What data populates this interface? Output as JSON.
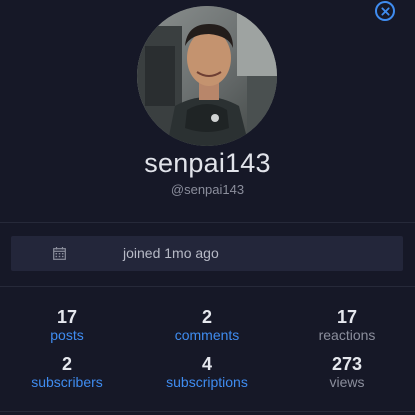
{
  "profile": {
    "display_name": "senpai143",
    "handle": "@senpai143",
    "joined": "joined 1mo ago"
  },
  "icons": {
    "close": "close-icon",
    "calendar": "calendar-icon"
  },
  "colors": {
    "background": "#161827",
    "accent": "#3f8cf0",
    "panel": "#23263a"
  },
  "stats": {
    "posts": {
      "value": "17",
      "label": "posts"
    },
    "comments": {
      "value": "2",
      "label": "comments"
    },
    "reactions": {
      "value": "17",
      "label": "reactions"
    },
    "subscribers": {
      "value": "2",
      "label": "subscribers"
    },
    "subscriptions": {
      "value": "4",
      "label": "subscriptions"
    },
    "views": {
      "value": "273",
      "label": "views"
    }
  }
}
